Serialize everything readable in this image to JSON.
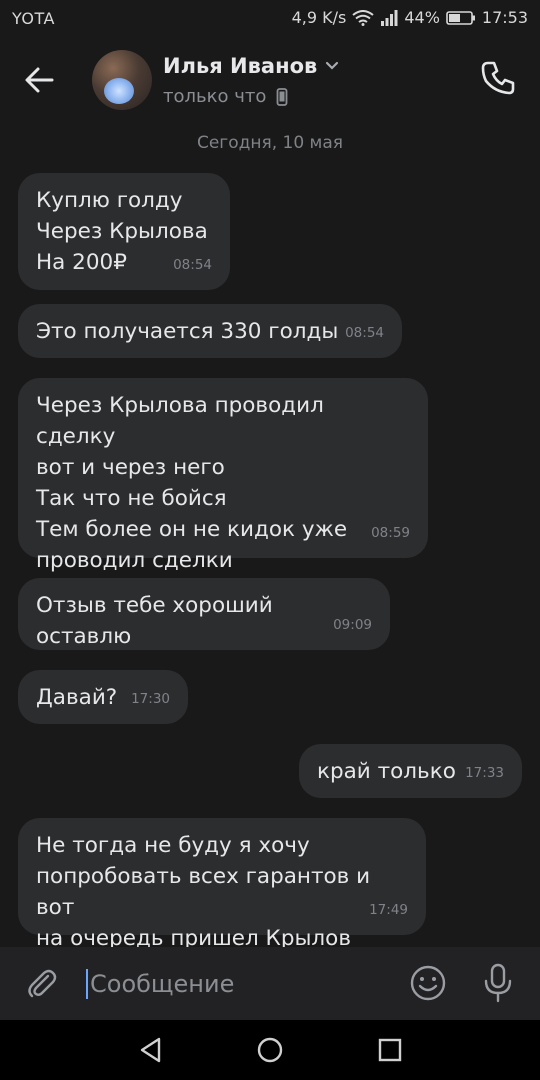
{
  "statusbar": {
    "carrier": "YOTA",
    "speed": "4,9 K/s",
    "battery": "44%",
    "time": "17:53"
  },
  "header": {
    "name": "Илья Иванов",
    "status": "только что"
  },
  "date_separator": "Сегодня, 10 мая",
  "messages": [
    {
      "text": "Куплю голду\nЧерез Крылова\nНа 200₽",
      "time": "08:54",
      "direction": "in"
    },
    {
      "text": "Это получается 330 голды",
      "time": "08:54",
      "direction": "in"
    },
    {
      "text": "Через Крылова проводил сделку\nвот и через него\nТак что не бойся\nТем более он не кидок уже\nпроводил сделки",
      "time": "08:59",
      "direction": "in"
    },
    {
      "text": "Отзыв тебе хороший оставлю",
      "time": "09:09",
      "direction": "in"
    },
    {
      "text": "Давай?",
      "time": "17:30",
      "direction": "in"
    },
    {
      "text": "край только",
      "time": "17:33",
      "direction": "out"
    },
    {
      "text": "Не тогда не буду я хочу\nпопробовать всех гарантов и вот\nна очередь пришел Крылов",
      "time": "17:49",
      "direction": "in"
    }
  ],
  "composer": {
    "placeholder": "Сообщение",
    "value": ""
  },
  "colors": {
    "background": "#19191a",
    "bubble": "#2c2d2f",
    "accent": "#6aa6ff"
  }
}
